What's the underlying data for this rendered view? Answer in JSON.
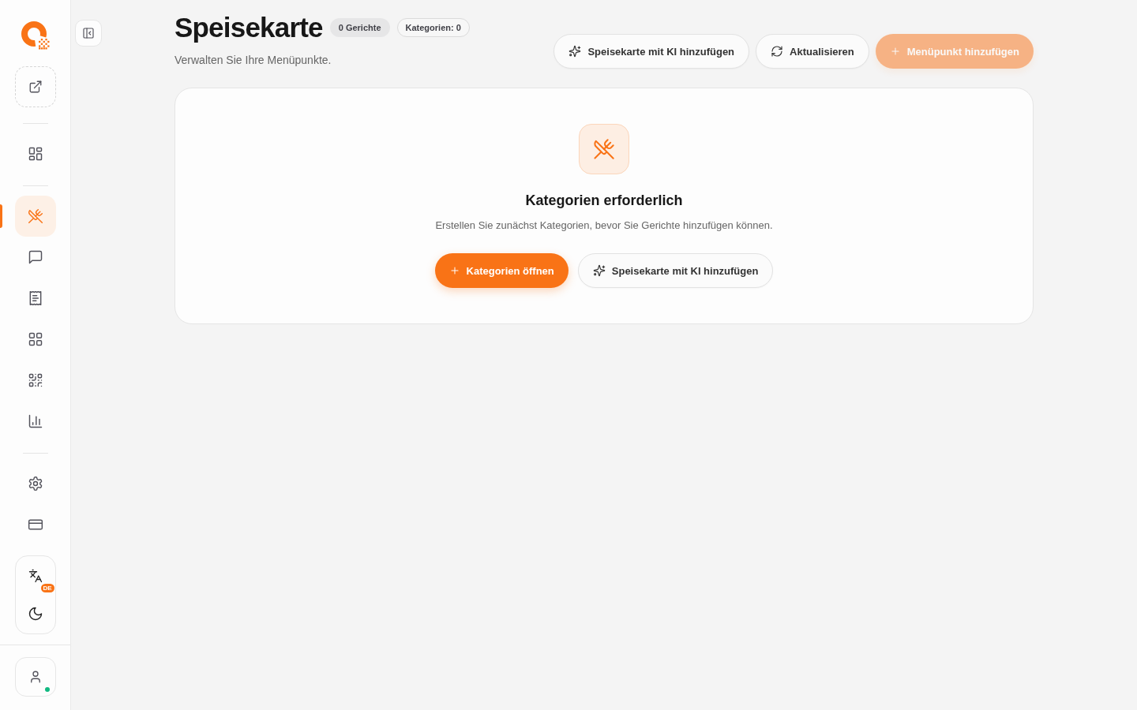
{
  "sidebar": {
    "nav_groups": [
      {
        "items": [
          {
            "selected": false
          }
        ]
      },
      {
        "items": [
          {
            "selected": true
          },
          {
            "selected": false
          },
          {
            "selected": false
          },
          {
            "selected": false
          },
          {
            "selected": false
          },
          {
            "selected": false
          }
        ]
      },
      {
        "items": [
          {
            "selected": false
          },
          {
            "selected": false
          }
        ]
      }
    ],
    "language_badge": "DE",
    "user": {
      "online": true
    }
  },
  "header": {
    "title": "Speisekarte",
    "badges": [
      {
        "kind": "filled",
        "text": "0 Gerichte"
      },
      {
        "kind": "outline",
        "text": "Kategorien: 0"
      }
    ],
    "subtitle": "Verwalten Sie Ihre Menüpunkte.",
    "actions": [
      {
        "kind": "ai",
        "label": "Speisekarte mit KI hinzufügen",
        "disabled": false
      },
      {
        "kind": "refresh",
        "label": "Aktualisieren",
        "disabled": false
      },
      {
        "kind": "add",
        "label": "Menüpunkt hinzufügen",
        "disabled": true
      }
    ]
  },
  "empty_state": {
    "title": "Kategorien erforderlich",
    "message": "Erstellen Sie zunächst Kategorien, bevor Sie Gerichte hinzufügen können.",
    "actions": [
      {
        "kind": "add",
        "label": "Kategorien öffnen"
      },
      {
        "kind": "ai",
        "label": "Speisekarte mit KI hinzufügen"
      }
    ]
  }
}
